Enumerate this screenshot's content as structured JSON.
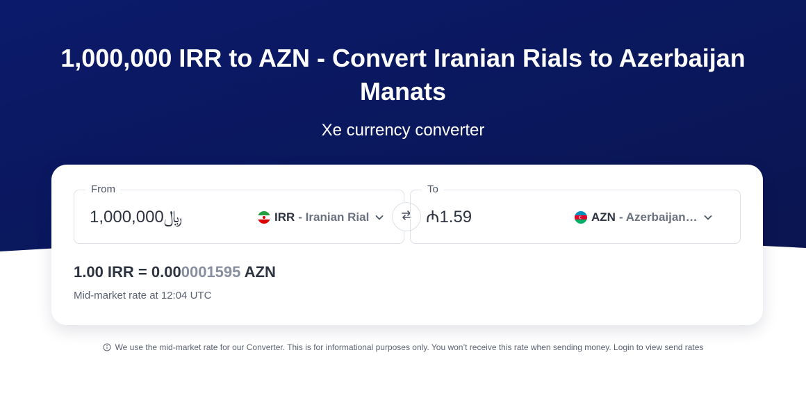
{
  "header": {
    "title": "1,000,000 IRR to AZN - Convert Iranian Rials to Azerbaijan Manats",
    "subtitle": "Xe currency converter"
  },
  "converter": {
    "from": {
      "label": "From",
      "amount": "﷼1,000,000",
      "currency_code": "IRR",
      "currency_name": "- Iranian Rial",
      "flag_icon": "iran-flag-icon"
    },
    "to": {
      "label": "To",
      "amount": "₼1.59",
      "currency_code": "AZN",
      "currency_name": "- Azerbaijan…",
      "flag_icon": "azerbaijan-flag-icon"
    },
    "swap_icon": "swap-arrows-icon",
    "rate": {
      "prefix": "1.00 IRR = 0.00",
      "faded_digits": "0001595",
      "suffix": " AZN"
    },
    "rate_time": "Mid-market rate at 12:04 UTC"
  },
  "disclaimer": {
    "icon": "info-icon",
    "text": "We use the mid-market rate for our Converter. This is for informational purposes only. You won’t receive this rate when sending money. Login to view send rates"
  },
  "colors": {
    "hero_top": "#0b1a6b",
    "hero_bottom": "#0a1550",
    "text_dark": "#2d3340",
    "text_muted": "#6b7280"
  }
}
